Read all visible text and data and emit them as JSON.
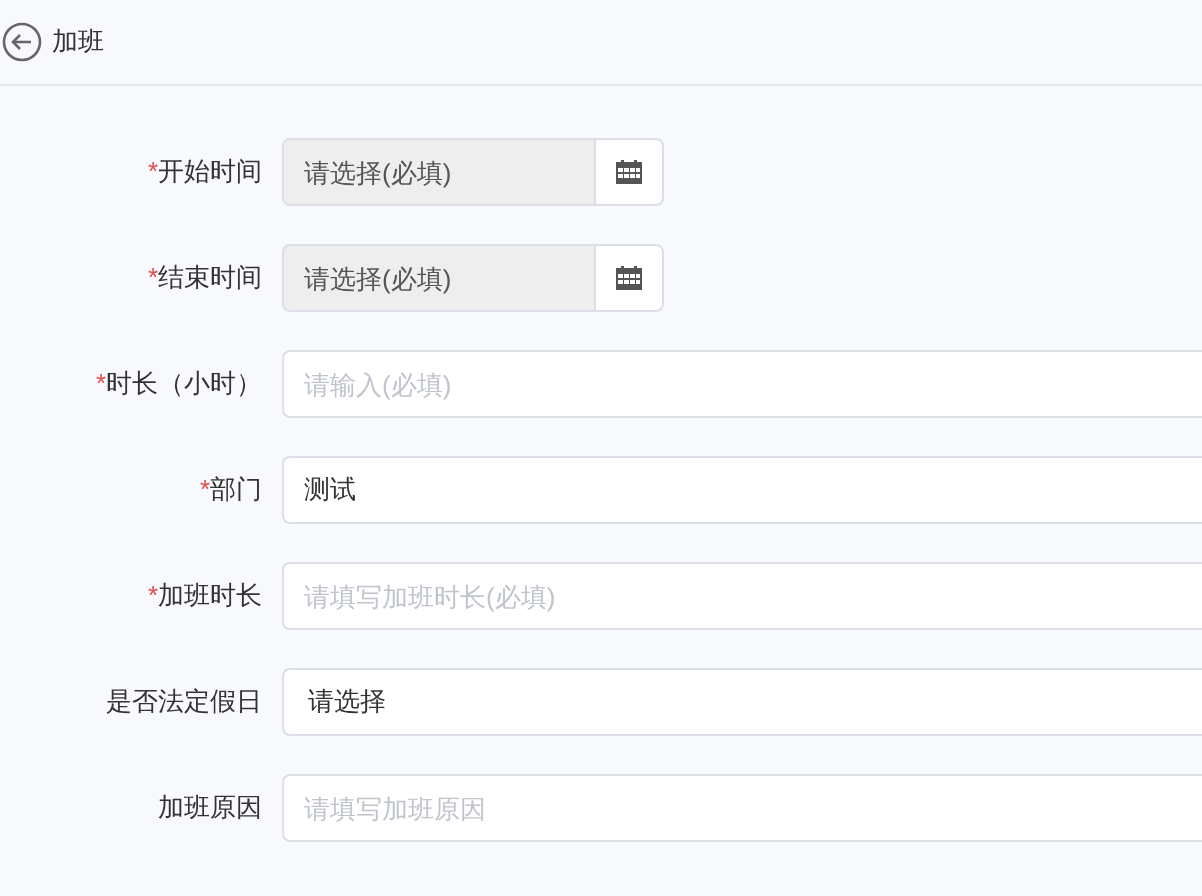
{
  "header": {
    "title": "加班"
  },
  "fields": [
    {
      "kind": "date",
      "required_mark": "*",
      "label": "开始时间",
      "placeholder": "请选择(必填)"
    },
    {
      "kind": "date",
      "required_mark": "*",
      "label": "结束时间",
      "placeholder": "请选择(必填)"
    },
    {
      "kind": "input",
      "required_mark": "*",
      "label": "时长（小时）",
      "placeholder": "请输入(必填)"
    },
    {
      "kind": "input",
      "required_mark": "*",
      "label": "部门",
      "value": "测试"
    },
    {
      "kind": "input",
      "required_mark": "*",
      "label": "加班时长",
      "placeholder": "请填写加班时长(必填)"
    },
    {
      "kind": "select",
      "label": "是否法定假日",
      "value": "请选择"
    },
    {
      "kind": "input",
      "label": "加班原因",
      "placeholder": "请填写加班原因"
    }
  ]
}
